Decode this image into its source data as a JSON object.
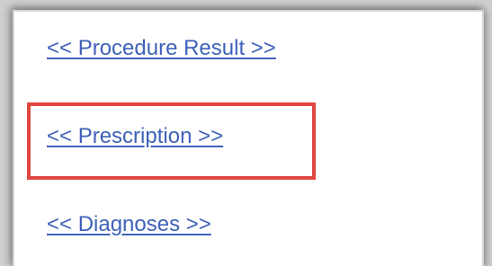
{
  "links": {
    "procedure_result": "<< Procedure Result >>",
    "prescription": "<< Prescription >>",
    "diagnoses": "<< Diagnoses >>"
  },
  "colors": {
    "link": "#3f62b8",
    "highlight": "#e0463f",
    "background": "#ffffff"
  }
}
